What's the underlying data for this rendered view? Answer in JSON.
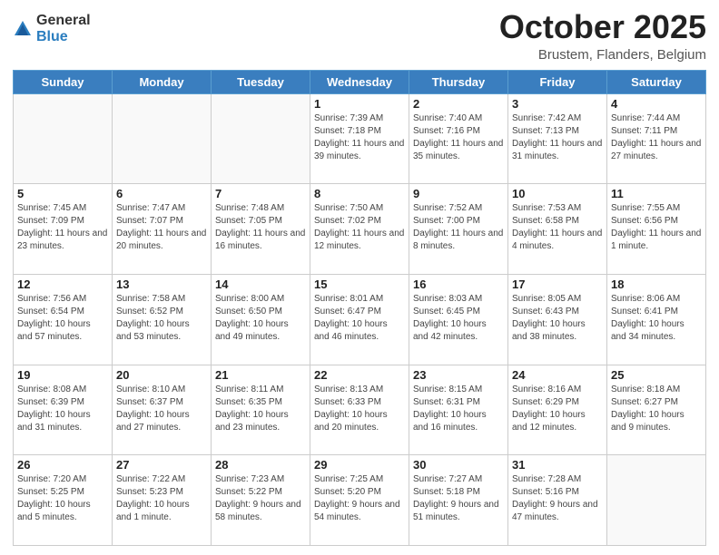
{
  "logo": {
    "general": "General",
    "blue": "Blue"
  },
  "header": {
    "month": "October 2025",
    "location": "Brustem, Flanders, Belgium"
  },
  "weekdays": [
    "Sunday",
    "Monday",
    "Tuesday",
    "Wednesday",
    "Thursday",
    "Friday",
    "Saturday"
  ],
  "weeks": [
    [
      {
        "day": "",
        "sunrise": "",
        "sunset": "",
        "daylight": ""
      },
      {
        "day": "",
        "sunrise": "",
        "sunset": "",
        "daylight": ""
      },
      {
        "day": "",
        "sunrise": "",
        "sunset": "",
        "daylight": ""
      },
      {
        "day": "1",
        "sunrise": "Sunrise: 7:39 AM",
        "sunset": "Sunset: 7:18 PM",
        "daylight": "Daylight: 11 hours and 39 minutes."
      },
      {
        "day": "2",
        "sunrise": "Sunrise: 7:40 AM",
        "sunset": "Sunset: 7:16 PM",
        "daylight": "Daylight: 11 hours and 35 minutes."
      },
      {
        "day": "3",
        "sunrise": "Sunrise: 7:42 AM",
        "sunset": "Sunset: 7:13 PM",
        "daylight": "Daylight: 11 hours and 31 minutes."
      },
      {
        "day": "4",
        "sunrise": "Sunrise: 7:44 AM",
        "sunset": "Sunset: 7:11 PM",
        "daylight": "Daylight: 11 hours and 27 minutes."
      }
    ],
    [
      {
        "day": "5",
        "sunrise": "Sunrise: 7:45 AM",
        "sunset": "Sunset: 7:09 PM",
        "daylight": "Daylight: 11 hours and 23 minutes."
      },
      {
        "day": "6",
        "sunrise": "Sunrise: 7:47 AM",
        "sunset": "Sunset: 7:07 PM",
        "daylight": "Daylight: 11 hours and 20 minutes."
      },
      {
        "day": "7",
        "sunrise": "Sunrise: 7:48 AM",
        "sunset": "Sunset: 7:05 PM",
        "daylight": "Daylight: 11 hours and 16 minutes."
      },
      {
        "day": "8",
        "sunrise": "Sunrise: 7:50 AM",
        "sunset": "Sunset: 7:02 PM",
        "daylight": "Daylight: 11 hours and 12 minutes."
      },
      {
        "day": "9",
        "sunrise": "Sunrise: 7:52 AM",
        "sunset": "Sunset: 7:00 PM",
        "daylight": "Daylight: 11 hours and 8 minutes."
      },
      {
        "day": "10",
        "sunrise": "Sunrise: 7:53 AM",
        "sunset": "Sunset: 6:58 PM",
        "daylight": "Daylight: 11 hours and 4 minutes."
      },
      {
        "day": "11",
        "sunrise": "Sunrise: 7:55 AM",
        "sunset": "Sunset: 6:56 PM",
        "daylight": "Daylight: 11 hours and 1 minute."
      }
    ],
    [
      {
        "day": "12",
        "sunrise": "Sunrise: 7:56 AM",
        "sunset": "Sunset: 6:54 PM",
        "daylight": "Daylight: 10 hours and 57 minutes."
      },
      {
        "day": "13",
        "sunrise": "Sunrise: 7:58 AM",
        "sunset": "Sunset: 6:52 PM",
        "daylight": "Daylight: 10 hours and 53 minutes."
      },
      {
        "day": "14",
        "sunrise": "Sunrise: 8:00 AM",
        "sunset": "Sunset: 6:50 PM",
        "daylight": "Daylight: 10 hours and 49 minutes."
      },
      {
        "day": "15",
        "sunrise": "Sunrise: 8:01 AM",
        "sunset": "Sunset: 6:47 PM",
        "daylight": "Daylight: 10 hours and 46 minutes."
      },
      {
        "day": "16",
        "sunrise": "Sunrise: 8:03 AM",
        "sunset": "Sunset: 6:45 PM",
        "daylight": "Daylight: 10 hours and 42 minutes."
      },
      {
        "day": "17",
        "sunrise": "Sunrise: 8:05 AM",
        "sunset": "Sunset: 6:43 PM",
        "daylight": "Daylight: 10 hours and 38 minutes."
      },
      {
        "day": "18",
        "sunrise": "Sunrise: 8:06 AM",
        "sunset": "Sunset: 6:41 PM",
        "daylight": "Daylight: 10 hours and 34 minutes."
      }
    ],
    [
      {
        "day": "19",
        "sunrise": "Sunrise: 8:08 AM",
        "sunset": "Sunset: 6:39 PM",
        "daylight": "Daylight: 10 hours and 31 minutes."
      },
      {
        "day": "20",
        "sunrise": "Sunrise: 8:10 AM",
        "sunset": "Sunset: 6:37 PM",
        "daylight": "Daylight: 10 hours and 27 minutes."
      },
      {
        "day": "21",
        "sunrise": "Sunrise: 8:11 AM",
        "sunset": "Sunset: 6:35 PM",
        "daylight": "Daylight: 10 hours and 23 minutes."
      },
      {
        "day": "22",
        "sunrise": "Sunrise: 8:13 AM",
        "sunset": "Sunset: 6:33 PM",
        "daylight": "Daylight: 10 hours and 20 minutes."
      },
      {
        "day": "23",
        "sunrise": "Sunrise: 8:15 AM",
        "sunset": "Sunset: 6:31 PM",
        "daylight": "Daylight: 10 hours and 16 minutes."
      },
      {
        "day": "24",
        "sunrise": "Sunrise: 8:16 AM",
        "sunset": "Sunset: 6:29 PM",
        "daylight": "Daylight: 10 hours and 12 minutes."
      },
      {
        "day": "25",
        "sunrise": "Sunrise: 8:18 AM",
        "sunset": "Sunset: 6:27 PM",
        "daylight": "Daylight: 10 hours and 9 minutes."
      }
    ],
    [
      {
        "day": "26",
        "sunrise": "Sunrise: 7:20 AM",
        "sunset": "Sunset: 5:25 PM",
        "daylight": "Daylight: 10 hours and 5 minutes."
      },
      {
        "day": "27",
        "sunrise": "Sunrise: 7:22 AM",
        "sunset": "Sunset: 5:23 PM",
        "daylight": "Daylight: 10 hours and 1 minute."
      },
      {
        "day": "28",
        "sunrise": "Sunrise: 7:23 AM",
        "sunset": "Sunset: 5:22 PM",
        "daylight": "Daylight: 9 hours and 58 minutes."
      },
      {
        "day": "29",
        "sunrise": "Sunrise: 7:25 AM",
        "sunset": "Sunset: 5:20 PM",
        "daylight": "Daylight: 9 hours and 54 minutes."
      },
      {
        "day": "30",
        "sunrise": "Sunrise: 7:27 AM",
        "sunset": "Sunset: 5:18 PM",
        "daylight": "Daylight: 9 hours and 51 minutes."
      },
      {
        "day": "31",
        "sunrise": "Sunrise: 7:28 AM",
        "sunset": "Sunset: 5:16 PM",
        "daylight": "Daylight: 9 hours and 47 minutes."
      },
      {
        "day": "",
        "sunrise": "",
        "sunset": "",
        "daylight": ""
      }
    ]
  ]
}
